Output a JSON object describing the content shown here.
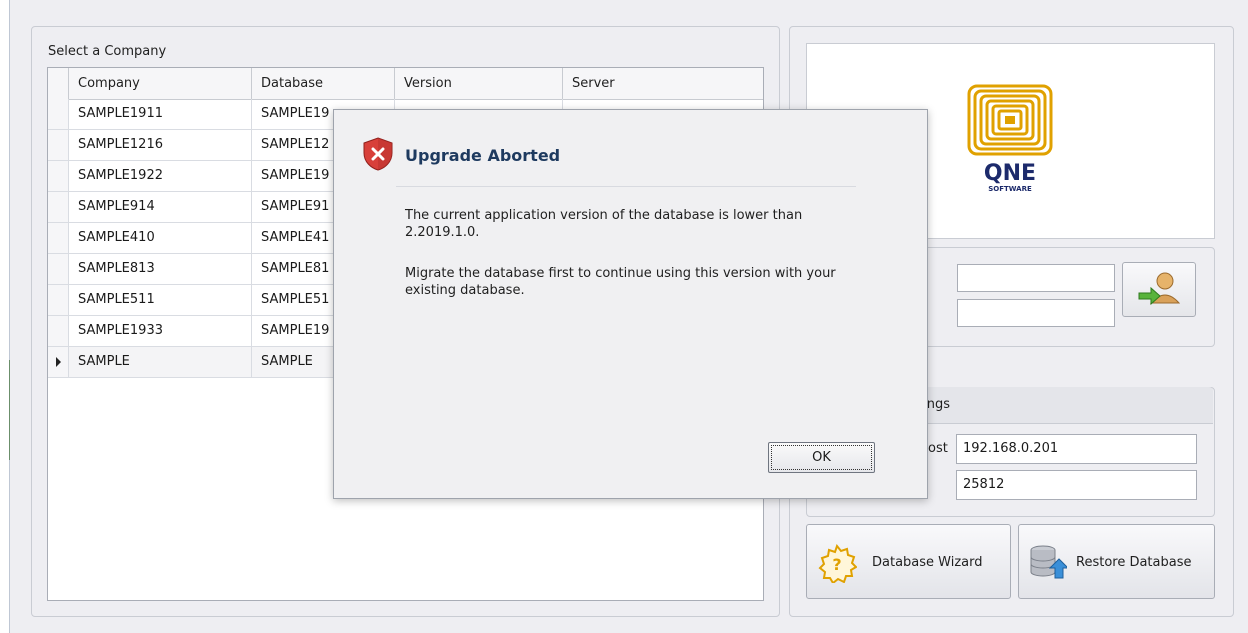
{
  "company_panel": {
    "title": "Select a Company",
    "columns": [
      "Company",
      "Database",
      "Version",
      "Server"
    ],
    "rows": [
      {
        "company": "SAMPLE1911",
        "database": "SAMPLE19"
      },
      {
        "company": "SAMPLE1216",
        "database": "SAMPLE12"
      },
      {
        "company": "SAMPLE1922",
        "database": "SAMPLE19"
      },
      {
        "company": "SAMPLE914",
        "database": "SAMPLE91"
      },
      {
        "company": "SAMPLE410",
        "database": "SAMPLE41"
      },
      {
        "company": "SAMPLE813",
        "database": "SAMPLE81"
      },
      {
        "company": "SAMPLE511",
        "database": "SAMPLE51"
      },
      {
        "company": "SAMPLE1933",
        "database": "SAMPLE19"
      },
      {
        "company": "SAMPLE",
        "database": "SAMPLE"
      }
    ]
  },
  "logo": {
    "brand": "QNE",
    "sub": "SOFTWARE",
    "colors": {
      "gold": "#e0a100",
      "navy": "#1c2a6b"
    }
  },
  "login": {
    "username_value": "",
    "password_value": ""
  },
  "server_settings": {
    "title_visible": "ttings",
    "host_label_visible": "ost",
    "host_value": "192.168.0.201",
    "port_value": "25812"
  },
  "buttons": {
    "database_wizard": "Database Wizard",
    "restore_database": "Restore Database"
  },
  "dialog": {
    "title": "Upgrade Aborted",
    "message_1": "The current application version of the database is lower than 2.2019.1.0.",
    "message_2": "Migrate the database first to continue using this version with your existing database.",
    "ok_label": "OK"
  }
}
